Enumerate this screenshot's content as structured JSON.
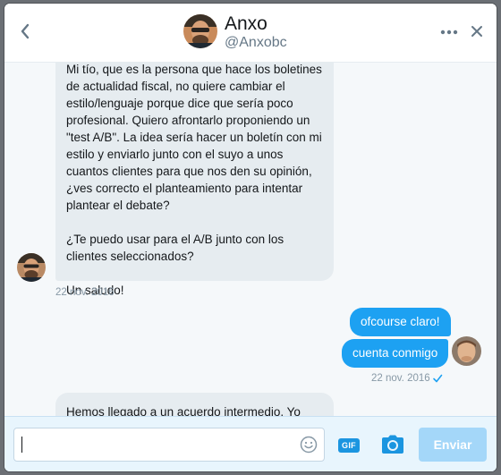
{
  "header": {
    "name": "Anxo",
    "handle": "@Anxobc"
  },
  "messages": {
    "incoming_first": {
      "paragraphs": [
        "Mi tío, que es la persona que hace los boletines de actualidad fiscal, no quiere cambiar el estilo/lenguaje porque dice que sería poco profesional. Quiero afrontarlo proponiendo un \"test A/B\". La idea sería hacer un boletín con mi estilo y enviarlo junto con el suyo a unos cuantos clientes para que nos den su opinión, ¿ves correcto el planteamiento para intentar plantear el debate?",
        "¿Te puedo usar para el A/B junto con los clientes seleccionados?",
        "Un saludo!"
      ],
      "timestamp": "22 nov. 2016"
    },
    "outgoing": [
      "ofcourse claro!",
      "cuenta conmigo"
    ],
    "outgoing_timestamp": "22 nov. 2016",
    "incoming_second": "Hemos llegado a un acuerdo intermedio. Yo haré un"
  },
  "composer": {
    "input_value": "",
    "gif_label": "GIF",
    "send_label": "Enviar"
  },
  "colors": {
    "accent": "#1da1f2",
    "send_disabled": "#a4d7f9",
    "incoming_bubble": "#e6ecf0"
  },
  "icons": {
    "back": "chevron-left-icon",
    "more": "more-dots-icon",
    "close": "close-icon",
    "emoji": "smiley-icon",
    "camera": "camera-icon",
    "read": "checkmark-icon"
  }
}
